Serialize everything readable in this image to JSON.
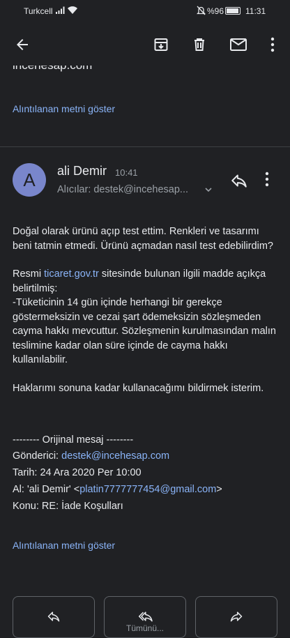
{
  "status_bar": {
    "carrier": "Turkcell",
    "battery": "%96",
    "time": "11:31"
  },
  "quoted_top": {
    "text": "incehesap.com",
    "show_quoted": "Alıntılanan metni göster"
  },
  "message": {
    "avatar_letter": "A",
    "sender": "ali Demir",
    "time": "10:41",
    "recipients": "Alıcılar: destek@incehesap...",
    "para1": "Doğal olarak ürünü açıp test ettim. Renkleri ve tasarımı beni tatmin etmedi. Ürünü açmadan nasıl test edebilirdim?",
    "para2_prefix": "Resmi ",
    "para2_link": "ticaret.gov.tr",
    "para2_suffix": " sitesinde bulunan ilgili madde açıkça belirtilmiş:",
    "para2_rest": "-Tüketicinin 14 gün içinde herhangi bir gerekçe göstermeksizin ve cezai şart ödemeksizin sözleşmeden cayma hakkı mevcuttur. Sözleşmenin kurulmasından malın teslimine kadar olan süre içinde de cayma hakkı kullanılabilir.",
    "para3": "Haklarımı sonuna kadar kullanacağımı bildirmek isterim.",
    "orig_header": "-------- Orijinal mesaj --------",
    "from_label": "Gönderici: ",
    "from_value": "destek@incehesap.com",
    "date_line": "Tarih: 24 Ara 2020 Per 10:00",
    "to_prefix": "Al: 'ali Demir' <",
    "to_value": "platin7777777454@gmail.com",
    "to_suffix": ">",
    "subject_line": "Konu: RE: İade Koşulları",
    "show_quoted": "Alıntılanan metni göster"
  },
  "actions": {
    "reply_all_partial": "Tümünü..."
  },
  "icons": {
    "back": "back-arrow-icon",
    "archive": "archive-icon",
    "delete": "trash-icon",
    "mark_unread": "mail-icon",
    "more": "more-vert-icon",
    "reply": "reply-icon",
    "reply_all": "reply-all-icon",
    "forward": "forward-icon"
  }
}
